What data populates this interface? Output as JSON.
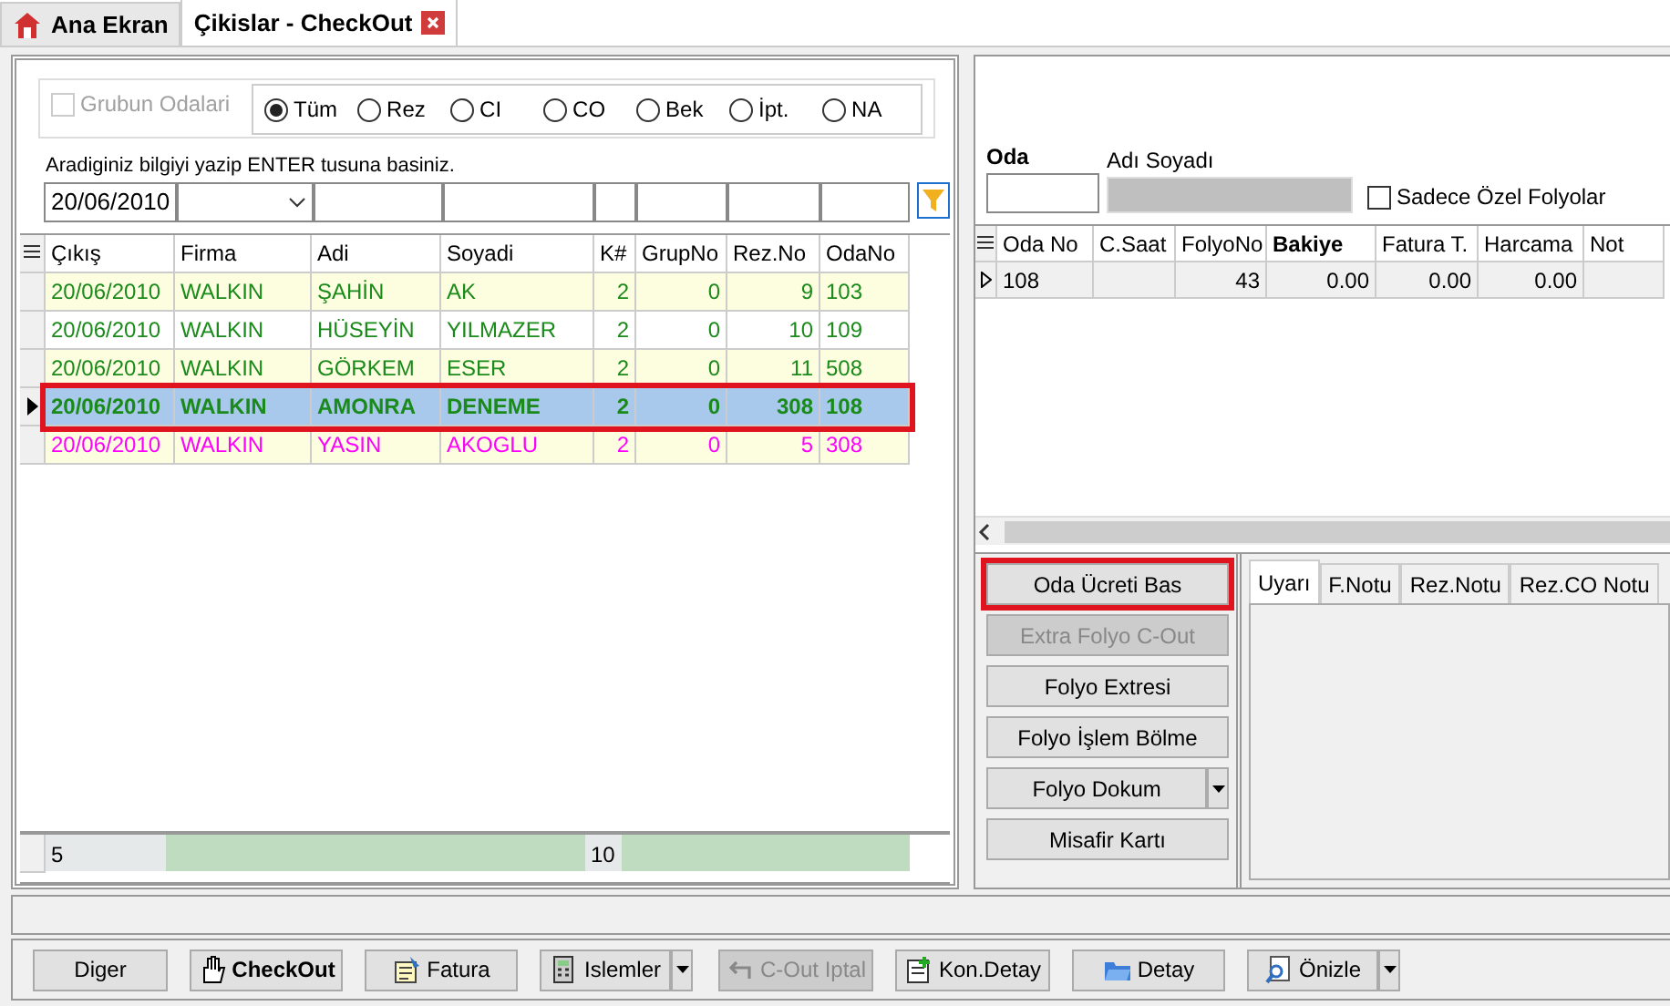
{
  "tabs": [
    {
      "label": "Ana Ekran",
      "selected": false,
      "kind": "home"
    },
    {
      "label": "Çikislar - CheckOut",
      "selected": true,
      "kind": "closable"
    }
  ],
  "filter": {
    "group_checkbox": {
      "label": "Grubun Odalari",
      "checked": false,
      "disabled": true
    },
    "radios": [
      {
        "label": "Tüm",
        "selected": true
      },
      {
        "label": "Rez",
        "selected": false
      },
      {
        "label": "CI",
        "selected": false
      },
      {
        "label": "CO",
        "selected": false
      },
      {
        "label": "Bek",
        "selected": false
      },
      {
        "label": "İpt.",
        "selected": false
      },
      {
        "label": "NA",
        "selected": false
      }
    ],
    "hint": "Aradiginiz bilgiyi yazip ENTER tusuna basiniz.",
    "fields": [
      {
        "kind": "text",
        "value": "20/06/2010"
      },
      {
        "kind": "dropdown"
      },
      {
        "kind": "text"
      },
      {
        "kind": "text"
      },
      {
        "kind": "text"
      },
      {
        "kind": "text"
      },
      {
        "kind": "text"
      },
      {
        "kind": "text"
      }
    ]
  },
  "checkout_table": {
    "columns": [
      "Çıkış",
      "Firma",
      "Adi",
      "Soyadi",
      "K#",
      "GrupNo",
      "Rez.No",
      "OdaNo"
    ],
    "rows": [
      {
        "cells": [
          "20/06/2010",
          "WALKIN",
          "ŞAHİN",
          "AK",
          "2",
          "0",
          "9",
          "103"
        ],
        "color": "#1a8a1a",
        "selected": false
      },
      {
        "cells": [
          "20/06/2010",
          "WALKIN",
          "HÜSEYİN",
          "YILMAZER",
          "2",
          "0",
          "10",
          "109"
        ],
        "color": "#1a8a1a",
        "selected": false
      },
      {
        "cells": [
          "20/06/2010",
          "WALKIN",
          "GÖRKEM",
          "ESER",
          "2",
          "0",
          "11",
          "508"
        ],
        "color": "#1a8a1a",
        "selected": false
      },
      {
        "cells": [
          "20/06/2010",
          "WALKIN",
          "AMONRA",
          "DENEME",
          "2",
          "0",
          "308",
          "108"
        ],
        "color": "#1a8a1a",
        "selected": true,
        "highlighted": true
      },
      {
        "cells": [
          "20/06/2010",
          "WALKIN",
          "YASIN",
          "AKOGLU",
          "2",
          "0",
          "5",
          "308"
        ],
        "color": "#ff00ff",
        "selected": false
      }
    ],
    "footer": [
      "5",
      "10"
    ]
  },
  "room": {
    "oda_label": "Oda",
    "name_label": "Adı Soyadı",
    "special_checkbox": {
      "label": "Sadece Özel Folyolar",
      "checked": false
    }
  },
  "folio_table": {
    "columns": [
      "Oda No",
      "C.Saat",
      "FolyoNo",
      "Bakiye",
      "Fatura T.",
      "Harcama",
      "Not"
    ],
    "rows": [
      {
        "cells": [
          "108",
          "",
          "43",
          "0.00",
          "0.00",
          "0.00",
          ""
        ]
      }
    ]
  },
  "side_buttons": [
    {
      "label": "Oda Ücreti Bas",
      "kind": "plain",
      "disabled": false,
      "highlighted": true
    },
    {
      "label": "Extra Folyo C-Out",
      "kind": "plain",
      "disabled": true
    },
    {
      "label": "Folyo Extresi",
      "kind": "plain",
      "disabled": false
    },
    {
      "label": "Folyo İşlem Bölme",
      "kind": "plain",
      "disabled": false
    },
    {
      "label": "Folyo Dokum",
      "kind": "split",
      "disabled": false
    },
    {
      "label": "Misafir Kartı",
      "kind": "plain",
      "disabled": false
    }
  ],
  "note_tabs": [
    {
      "label": "Uyarı",
      "selected": true
    },
    {
      "label": "F.Notu",
      "selected": false
    },
    {
      "label": "Rez.Notu",
      "selected": false
    },
    {
      "label": "Rez.CO Notu",
      "selected": false
    }
  ],
  "toolbar": [
    {
      "label": "Diger",
      "kind": "plain",
      "disabled": false
    },
    {
      "label": "CheckOut",
      "kind": "plain",
      "disabled": false
    },
    {
      "label": "Fatura",
      "kind": "plain",
      "disabled": false
    },
    {
      "label": "Islemler",
      "kind": "split",
      "disabled": false
    },
    {
      "label": "C-Out Iptal",
      "kind": "plain",
      "disabled": true
    },
    {
      "label": "Kon.Detay",
      "kind": "plain",
      "disabled": false
    },
    {
      "label": "Detay",
      "kind": "plain",
      "disabled": false
    },
    {
      "label": "Önizle",
      "kind": "split",
      "disabled": false
    }
  ]
}
